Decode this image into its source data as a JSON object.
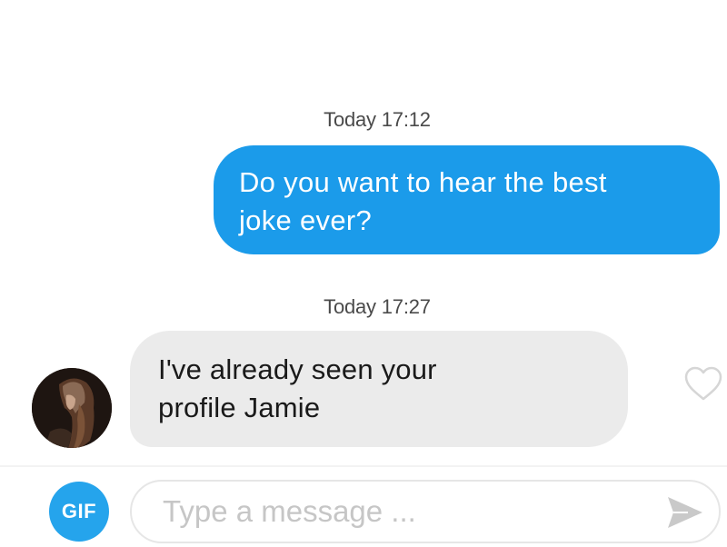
{
  "conversation": {
    "messages": [
      {
        "timestamp": "Today 17:12",
        "direction": "outgoing",
        "lines": [
          "Do you want to hear the best",
          "joke ever?"
        ]
      },
      {
        "timestamp": "Today 17:27",
        "direction": "incoming",
        "lines": [
          "I've already seen your",
          "profile Jamie"
        ]
      }
    ]
  },
  "composer": {
    "gif_label": "GIF",
    "placeholder": "Type a message ...",
    "value": ""
  },
  "icons": {
    "like": "heart-outline-icon",
    "send": "send-arrow-icon"
  },
  "colors": {
    "outgoing_bubble": "#1b9bea",
    "incoming_bubble": "#ebebeb",
    "gif_button": "#25a4ec",
    "placeholder_text": "#c6c6c6"
  }
}
